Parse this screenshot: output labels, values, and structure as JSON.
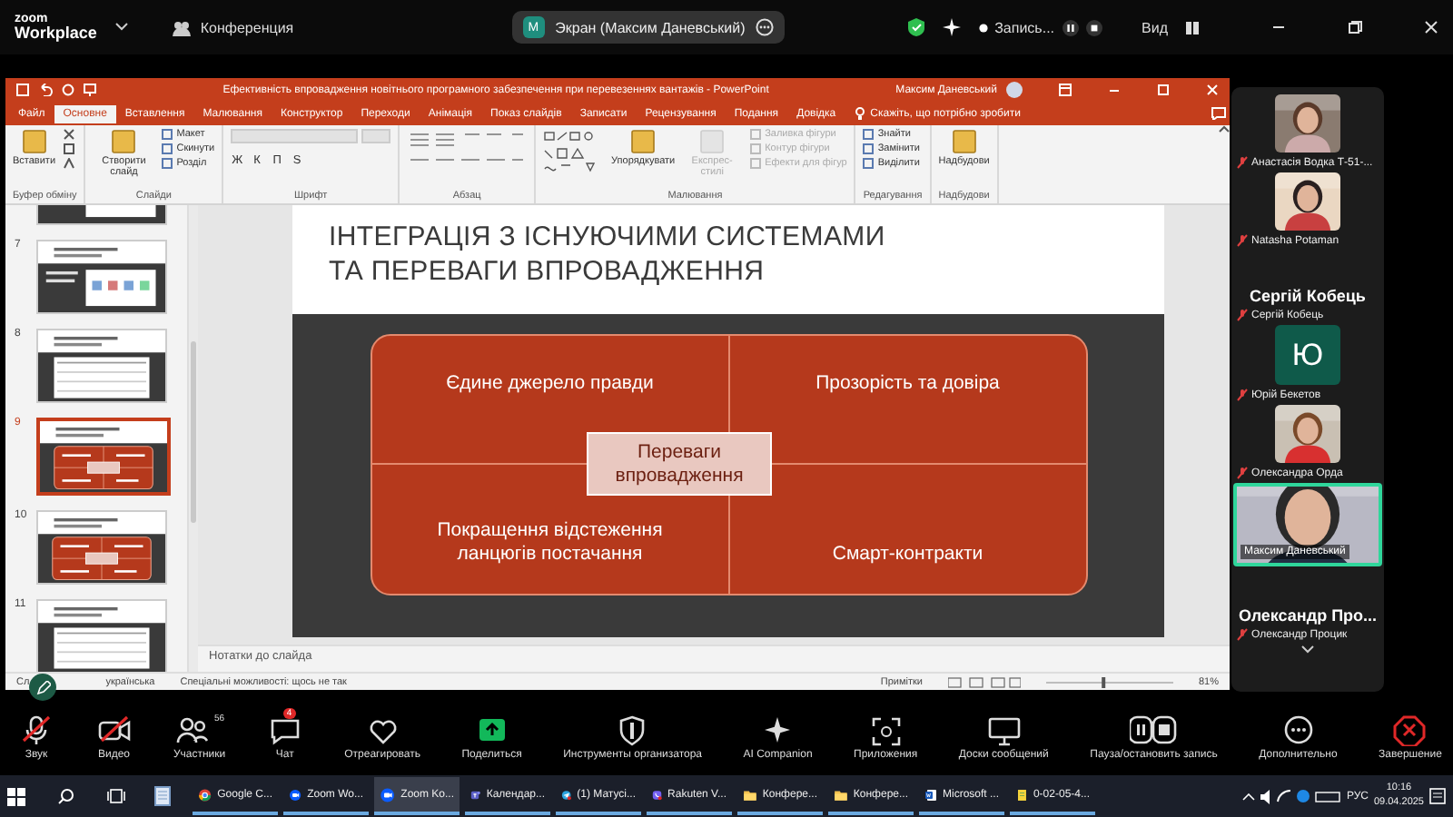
{
  "zoom_bar": {
    "logo_top": "zoom",
    "logo": "Workplace",
    "meeting": "Конференция",
    "share_badge": "M",
    "share_title": "Экран (Максим Даневський)",
    "recording": "Запись...",
    "view": "Вид"
  },
  "powerpoint": {
    "title": "Ефективність впровадження новітнього програмного забезпечення при перевезеннях вантажів  -  PowerPoint",
    "user": "Максим Даневський",
    "tabs": [
      {
        "label": "Файл",
        "selected": false
      },
      {
        "label": "Основне",
        "selected": true
      },
      {
        "label": "Вставлення",
        "selected": false
      },
      {
        "label": "Малювання",
        "selected": false
      },
      {
        "label": "Конструктор",
        "selected": false
      },
      {
        "label": "Переходи",
        "selected": false
      },
      {
        "label": "Анімація",
        "selected": false
      },
      {
        "label": "Показ слайдів",
        "selected": false
      },
      {
        "label": "Записати",
        "selected": false
      },
      {
        "label": "Рецензування",
        "selected": false
      },
      {
        "label": "Подання",
        "selected": false
      },
      {
        "label": "Довідка",
        "selected": false
      }
    ],
    "tell_me": "Скажіть, що потрібно зробити",
    "ribbon_groups": [
      {
        "kind": "clipboard",
        "title": "Буфер обміну",
        "large": [
          {
            "label": "Вставити",
            "disabled": false
          }
        ]
      },
      {
        "kind": "slides",
        "title": "Слайди",
        "large": [
          {
            "label": "Створити слайд",
            "disabled": false
          }
        ],
        "small": [
          {
            "label": "Макет",
            "disabled": false
          },
          {
            "label": "Скинути",
            "disabled": false
          },
          {
            "label": "Розділ",
            "disabled": false
          }
        ]
      },
      {
        "kind": "font",
        "title": "Шрифт",
        "format_buttons": [
          "Ж",
          "К",
          "П",
          "S"
        ]
      },
      {
        "kind": "paragraph",
        "title": "Абзац"
      },
      {
        "kind": "drawing",
        "title": "Малювання",
        "large": [
          {
            "label": "Упорядкувати",
            "disabled": false
          },
          {
            "label": "Експрес-стилі",
            "disabled": true
          }
        ],
        "small": [
          {
            "label": "Заливка фігури",
            "disabled": true
          },
          {
            "label": "Контур фігури",
            "disabled": true
          },
          {
            "label": "Ефекти для фігур",
            "disabled": true
          }
        ]
      },
      {
        "kind": "editing",
        "title": "Редагування",
        "small": [
          {
            "label": "Знайти",
            "disabled": false
          },
          {
            "label": "Замінити",
            "disabled": false
          },
          {
            "label": "Виділити",
            "disabled": false
          }
        ]
      },
      {
        "kind": "addins",
        "title": "Надбудови",
        "large": [
          {
            "label": "Надбудови",
            "disabled": false
          }
        ]
      }
    ],
    "thumbnails": [
      {
        "kind": "diagram",
        "selected": false
      },
      {
        "number": "7",
        "kind": "diagram",
        "selected": false
      },
      {
        "number": "8",
        "kind": "table",
        "selected": false
      },
      {
        "number": "9",
        "kind": "grid",
        "selected": true
      },
      {
        "number": "10",
        "kind": "grid",
        "selected": false
      },
      {
        "number": "11",
        "kind": "table",
        "selected": false
      }
    ],
    "slide": {
      "title_lines": [
        "ІНТЕГРАЦІЯ З ІСНУЮЧИМИ СИСТЕМАМИ",
        "ТА ПЕРЕВАГИ ВПРОВАДЖЕННЯ"
      ],
      "quadrants": [
        "Єдине джерело правди",
        "Прозорість та довіра",
        "Покращення відстеження ланцюгів постачання",
        "Смарт-контракти"
      ],
      "center": "Переваги впровадження"
    },
    "notes": "Нотатки до слайда",
    "status": {
      "slide": "Сл",
      "language": "українська",
      "accessibility": "Спеціальні можливості: щось не так",
      "notes": "Примітки",
      "zoom": "81%",
      "zoom_slider": {
        "level": 0.45
      }
    }
  },
  "participants": [
    {
      "kind": "video",
      "name": "Анастасія Водка Т-51-..."
    },
    {
      "kind": "video",
      "name": "Natasha Potaman"
    },
    {
      "kind": "name",
      "display": "Сергій Кобець",
      "name": "Сергій Кобець"
    },
    {
      "kind": "avatar",
      "initial": "Ю",
      "name": "Юрій Бекетов"
    },
    {
      "kind": "video",
      "name": "Олександра Орда"
    },
    {
      "kind": "wide",
      "name": "Максим Даневський",
      "speaking": true
    },
    {
      "kind": "name",
      "display": "Олександр  Про...",
      "name": "Олександр Процик"
    }
  ],
  "toolbar": [
    {
      "label": "Звук",
      "muted": true
    },
    {
      "label": "Видео",
      "muted": true
    },
    {
      "label": "Участники",
      "count": "56"
    },
    {
      "label": "Чат",
      "badge": "4"
    },
    {
      "label": "Отреагировать"
    },
    {
      "label": "Поделиться"
    },
    {
      "label": "Инструменты организатора"
    },
    {
      "label": "AI Companion"
    },
    {
      "label": "Приложения"
    },
    {
      "label": "Доски сообщений"
    },
    {
      "label": "Пауза/остановить запись"
    },
    {
      "label": "Дополнительно"
    },
    {
      "label": "Завершение"
    }
  ],
  "taskbar": {
    "apps": [
      {
        "label": "Google C...",
        "active": false
      },
      {
        "label": "Zoom Wo...",
        "active": false
      },
      {
        "label": "Zoom Ko...",
        "active": true
      },
      {
        "label": "Календар...",
        "active": false
      },
      {
        "label": "(1) Матусі...",
        "active": false
      },
      {
        "label": "Rakuten V...",
        "active": false
      },
      {
        "label": "Конфере...",
        "active": false
      },
      {
        "label": "Конфере...",
        "active": false
      },
      {
        "label": "Microsoft ...",
        "active": false
      },
      {
        "label": "0-02-05-4...",
        "active": false
      }
    ],
    "language": "РУС",
    "time": "10:16",
    "date": "09.04.2025"
  }
}
